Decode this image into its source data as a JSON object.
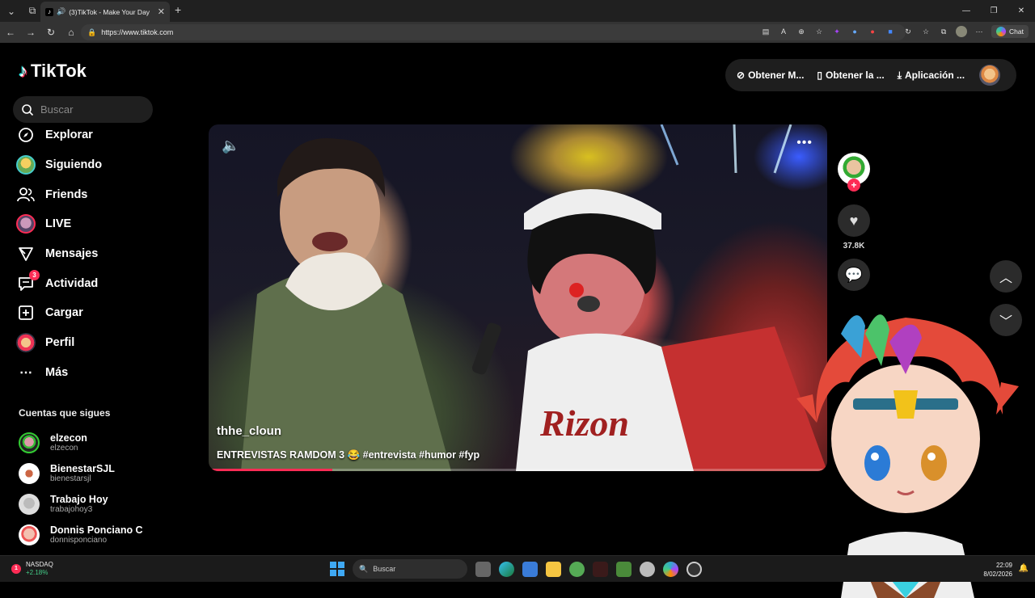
{
  "browser": {
    "tab_title": "(3)TikTok - Make Your Day",
    "url": "https://www.tiktok.com",
    "chat_label": "Chat"
  },
  "tiktok": {
    "logo": "TikTok",
    "search_placeholder": "Buscar",
    "nav": [
      {
        "label": "Explorar",
        "icon": "compass-icon"
      },
      {
        "label": "Siguiendo",
        "icon": "avatar"
      },
      {
        "label": "Friends",
        "icon": "friends-icon"
      },
      {
        "label": "LIVE",
        "icon": "live-avatar"
      },
      {
        "label": "Mensajes",
        "icon": "send-icon"
      },
      {
        "label": "Actividad",
        "icon": "inbox-icon",
        "badge": "3"
      },
      {
        "label": "Cargar",
        "icon": "plus-square-icon"
      },
      {
        "label": "Perfil",
        "icon": "profile-avatar"
      },
      {
        "label": "Más",
        "icon": "ellipsis-icon"
      }
    ],
    "following_title": "Cuentas que sigues",
    "accounts": [
      {
        "name": "elzecon",
        "username": "elzecon"
      },
      {
        "name": "BienestarSJL",
        "username": "bienestarsjl"
      },
      {
        "name": "Trabajo Hoy",
        "username": "trabajohoy3"
      },
      {
        "name": "Donnis Ponciano C",
        "username": "donnisponciano"
      }
    ],
    "top_actions": [
      "Obtener M...",
      "Obtener la ...",
      "Aplicación ..."
    ],
    "video": {
      "author": "thhe_cloun",
      "description": "ENTREVISTAS RAMDOM 3 😂 #entrevista #humor  #fyp",
      "progress": 0.2
    },
    "likes": "37.8K"
  },
  "taskbar": {
    "stock_name": "NASDAQ",
    "stock_change": "+2.18%",
    "stock_badge": "1",
    "search_label": "Buscar",
    "time": "22:09",
    "date": "8/02/2026"
  }
}
